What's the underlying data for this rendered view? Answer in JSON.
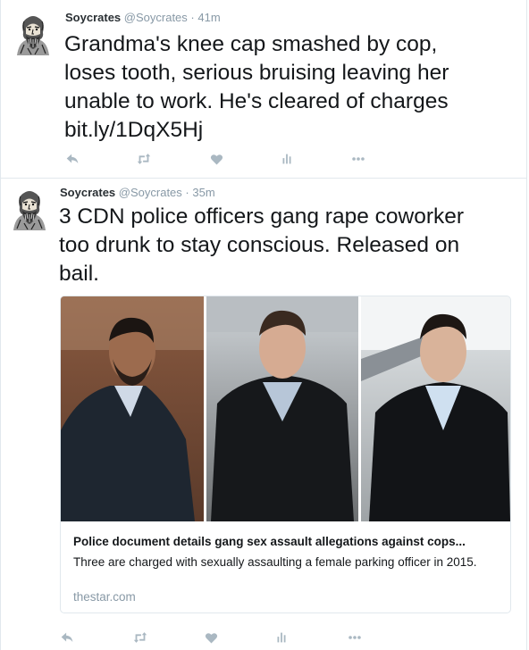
{
  "tweets": [
    {
      "author": "Soycrates",
      "handle": "@Soycrates",
      "separator": "·",
      "time": "41m",
      "text_lines": [
        "Grandma's knee cap smashed by cop,",
        "loses tooth, serious bruising leaving her",
        "unable to work. He's cleared of charges",
        "bit.ly/1DqX5Hj"
      ]
    },
    {
      "author": "Soycrates",
      "handle": "@Soycrates",
      "separator": "·",
      "time": "35m",
      "text_lines": [
        "3 CDN  police officers gang rape coworker",
        "too drunk to stay conscious. Released on",
        "bail."
      ],
      "card": {
        "title": "Police document details gang sex assault allegations against cops...",
        "description": "Three are charged with sexually assaulting a female parking officer in 2015.",
        "domain": "thestar.com"
      }
    }
  ],
  "action_icons": [
    "reply-icon",
    "retweet-icon",
    "like-icon",
    "analytics-icon",
    "more-icon"
  ],
  "colors": {
    "action_icon": "#aab8c2",
    "text": "#14171a",
    "muted": "#8899a6",
    "border": "#e1e8ed"
  }
}
